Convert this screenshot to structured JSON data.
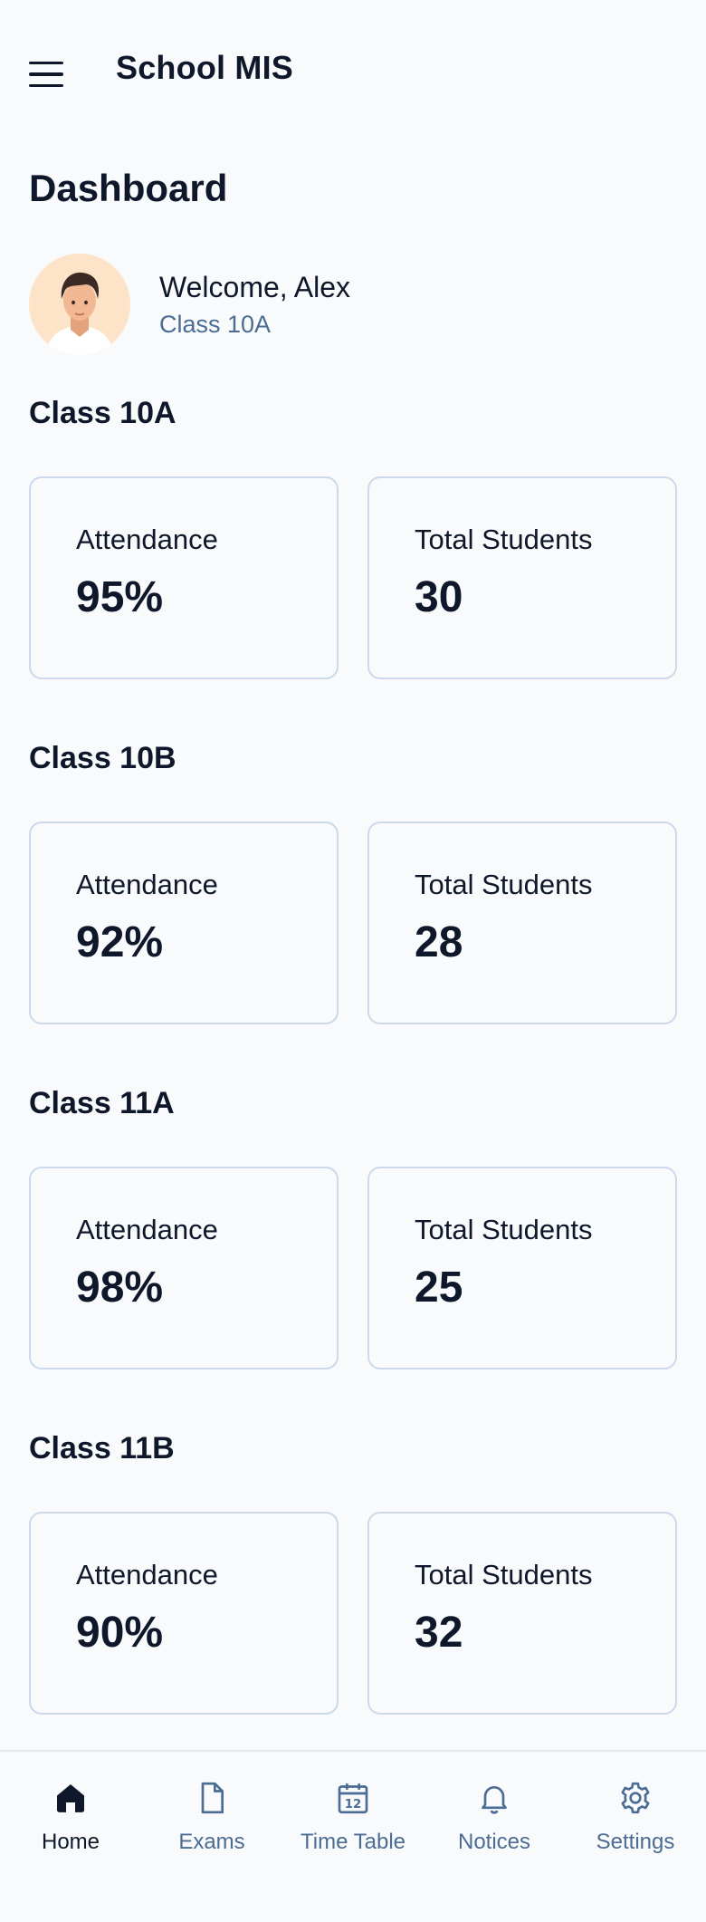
{
  "app": {
    "title": "School MIS"
  },
  "page": {
    "title": "Dashboard"
  },
  "welcome": {
    "greeting": "Welcome, Alex",
    "class_name": "Class 10A"
  },
  "sections": [
    {
      "title": "Class 10A",
      "cards": [
        {
          "label": "Attendance",
          "value": "95%"
        },
        {
          "label": "Total Students",
          "value": "30"
        }
      ]
    },
    {
      "title": "Class 10B",
      "cards": [
        {
          "label": "Attendance",
          "value": "92%"
        },
        {
          "label": "Total Students",
          "value": "28"
        }
      ]
    },
    {
      "title": "Class 11A",
      "cards": [
        {
          "label": "Attendance",
          "value": "98%"
        },
        {
          "label": "Total Students",
          "value": "25"
        }
      ]
    },
    {
      "title": "Class 11B",
      "cards": [
        {
          "label": "Attendance",
          "value": "90%"
        },
        {
          "label": "Total Students",
          "value": "32"
        }
      ]
    }
  ],
  "nav": {
    "items": [
      {
        "label": "Home",
        "icon": "home-icon",
        "active": true
      },
      {
        "label": "Exams",
        "icon": "document-icon",
        "active": false
      },
      {
        "label": "Time Table",
        "icon": "calendar-icon",
        "active": false
      },
      {
        "label": "Notices",
        "icon": "bell-icon",
        "active": false
      },
      {
        "label": "Settings",
        "icon": "gear-icon",
        "active": false
      }
    ],
    "calendar_day": "12"
  },
  "colors": {
    "background": "#f8fafc",
    "text": "#0f172a",
    "muted": "#4b6c94",
    "card_border": "#cbd9ea",
    "avatar_bg": "#fde4c8"
  }
}
